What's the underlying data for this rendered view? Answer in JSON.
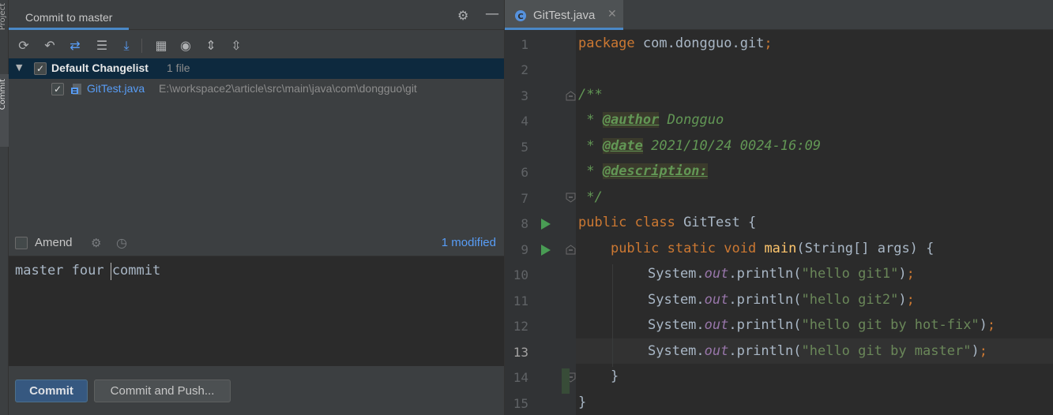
{
  "strip": {
    "project_label": "Project",
    "commit_label": "Commit"
  },
  "commit_panel": {
    "title": "Commit to master",
    "header_icons": [
      "gear-icon",
      "minimize-icon"
    ],
    "toolbar": [
      {
        "name": "refresh-icon",
        "glyph": "⟳"
      },
      {
        "name": "rollback-icon",
        "glyph": "↶"
      },
      {
        "name": "diff-icon",
        "glyph": "⇄"
      },
      {
        "name": "changelist-icon",
        "glyph": "☰"
      },
      {
        "name": "shelve-icon",
        "glyph": "⤓"
      },
      {
        "name": "group-by-icon",
        "glyph": "▦"
      },
      {
        "name": "show-icon",
        "glyph": "◉"
      },
      {
        "name": "expand-all-icon",
        "glyph": "⇕"
      },
      {
        "name": "collapse-all-icon",
        "glyph": "⇳"
      }
    ],
    "changelist": {
      "name": "Default Changelist",
      "count": "1 file",
      "checked": true,
      "files": [
        {
          "name": "GitTest.java",
          "path": "E:\\workspace2\\article\\src\\main\\java\\com\\dongguo\\git",
          "checked": true
        }
      ]
    },
    "amend": {
      "label": "Amend",
      "checked": false
    },
    "modified": "1 modified",
    "message": "master four commit",
    "buttons": {
      "commit": "Commit",
      "commit_and_push": "Commit and Push..."
    }
  },
  "editor": {
    "tab": {
      "label": "GitTest.java"
    },
    "current_line": 13,
    "line_numbers": [
      "1",
      "2",
      "3",
      "4",
      "5",
      "6",
      "7",
      "8",
      "9",
      "10",
      "11",
      "12",
      "13",
      "14",
      "15"
    ],
    "code": {
      "l1": {
        "kw": "package",
        "rest": " com.dongguo.git",
        "semi": ";"
      },
      "l3": "/**",
      "l4": {
        "star": " * ",
        "tag": "@author",
        "text": " Dongguo"
      },
      "l5": {
        "star": " * ",
        "tag": "@date",
        "text": " 2021/10/24 0024-16:09"
      },
      "l6": {
        "star": " * ",
        "tag": "@description:"
      },
      "l7": " */",
      "l8": {
        "kw": "public class",
        "rest": " GitTest {"
      },
      "l9": {
        "indent": "    ",
        "kw": "public static void",
        "space": " ",
        "fn": "main",
        "rest": "(String[] args) {"
      },
      "prints": [
        {
          "pre": "System.",
          "fld": "out",
          "mid": ".println(",
          "str": "\"hello git1\"",
          "end": ")",
          "semi": ";"
        },
        {
          "pre": "System.",
          "fld": "out",
          "mid": ".println(",
          "str": "\"hello git2\"",
          "end": ")",
          "semi": ";"
        },
        {
          "pre": "System.",
          "fld": "out",
          "mid": ".println(",
          "str": "\"hello git by hot-fix\"",
          "end": ")",
          "semi": ";"
        },
        {
          "pre": "System.",
          "fld": "out",
          "mid": ".println(",
          "str": "\"hello git by master\"",
          "end": ")",
          "semi": ";"
        }
      ],
      "l14": "    }",
      "l15": "}"
    }
  },
  "colors": {
    "accent": "#4a88c7",
    "link": "#589df6",
    "keyword": "#cc7832",
    "string": "#6a8759",
    "comment": "#629755",
    "run": "#499c54"
  }
}
